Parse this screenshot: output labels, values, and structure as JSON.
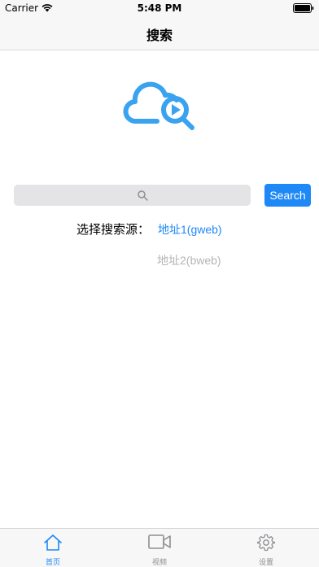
{
  "status_bar": {
    "carrier": "Carrier",
    "time": "5:48 PM"
  },
  "nav": {
    "title": "搜索"
  },
  "search": {
    "placeholder": "",
    "button_label": "Search"
  },
  "source": {
    "label": "选择搜索源：",
    "options": [
      {
        "label": "地址1(gweb)",
        "selected": true
      },
      {
        "label": "地址2(bweb)",
        "selected": false
      }
    ]
  },
  "tabs": [
    {
      "label": "首页",
      "icon": "home-icon",
      "active": true
    },
    {
      "label": "视频",
      "icon": "video-camera-icon",
      "active": false
    },
    {
      "label": "设置",
      "icon": "gear-icon",
      "active": false
    }
  ],
  "colors": {
    "accent": "#1e88f7",
    "logo": "#3aa3f0",
    "inactive_option": "#b4b4b4",
    "search_field": "#e4e4e7",
    "bar_background": "#f7f7f7"
  }
}
